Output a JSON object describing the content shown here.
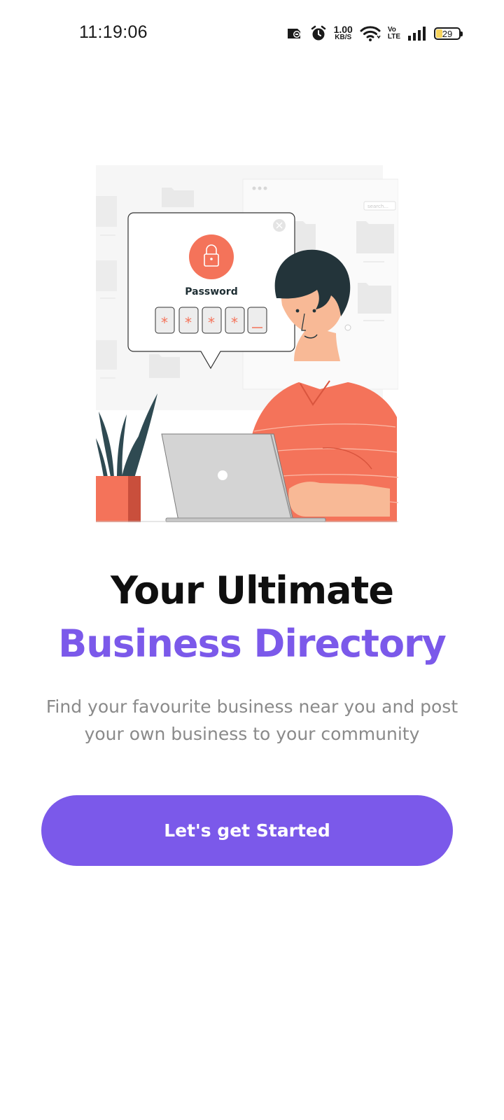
{
  "status_bar": {
    "time": "11:19:06",
    "net_speed_value": "1.00",
    "net_speed_unit": "KB/S",
    "volte_top": "Vo",
    "volte_bottom": "LTE",
    "battery_percent": 29,
    "battery_label": "29",
    "icons": [
      "notification-icon",
      "alarm-icon",
      "wifi-icon",
      "signal-icon",
      "battery-icon"
    ]
  },
  "illustration": {
    "dialog_title": "Password",
    "search_placeholder": "search...",
    "password_mask": [
      "*",
      "*",
      "*",
      "*",
      "_"
    ],
    "colors": {
      "accent": "#f4735a",
      "skin": "#f8b996",
      "hair": "#23343a",
      "laptop": "#d4d4d4",
      "plant": "#2f4a52"
    }
  },
  "headline": {
    "line1": "Your Ultimate",
    "line2": "Business Directory"
  },
  "subtitle": "Find your favourite business near you and post your own business to your community",
  "cta": {
    "label": "Let's get Started"
  },
  "colors": {
    "primary": "#7b59ea",
    "text_dark": "#0f0f0f",
    "text_muted": "#8a8a8a"
  }
}
